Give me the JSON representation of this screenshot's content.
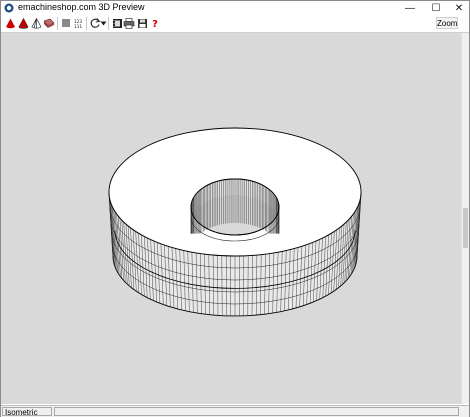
{
  "window": {
    "title": "emachineshop.com 3D Preview",
    "controls": {
      "minimize": "—",
      "maximize": "☐",
      "close": "✕"
    }
  },
  "toolbar": {
    "zoom_label": "Zoom",
    "icons": [
      "red-cone-icon",
      "cone-outline-icon",
      "cone-wireframe-icon",
      "shaded-part-icon",
      "gray-square-icon",
      "grid-numbers-icon",
      "rotate-icon",
      "dropdown-arrow-icon",
      "film-icon",
      "print-icon",
      "save-icon",
      "help-icon"
    ]
  },
  "status": {
    "view_label": "Isometric"
  },
  "colors": {
    "viewport_bg": "#d9d9d9",
    "part_fill": "#ffffff",
    "accent_red": "#cc0000"
  }
}
